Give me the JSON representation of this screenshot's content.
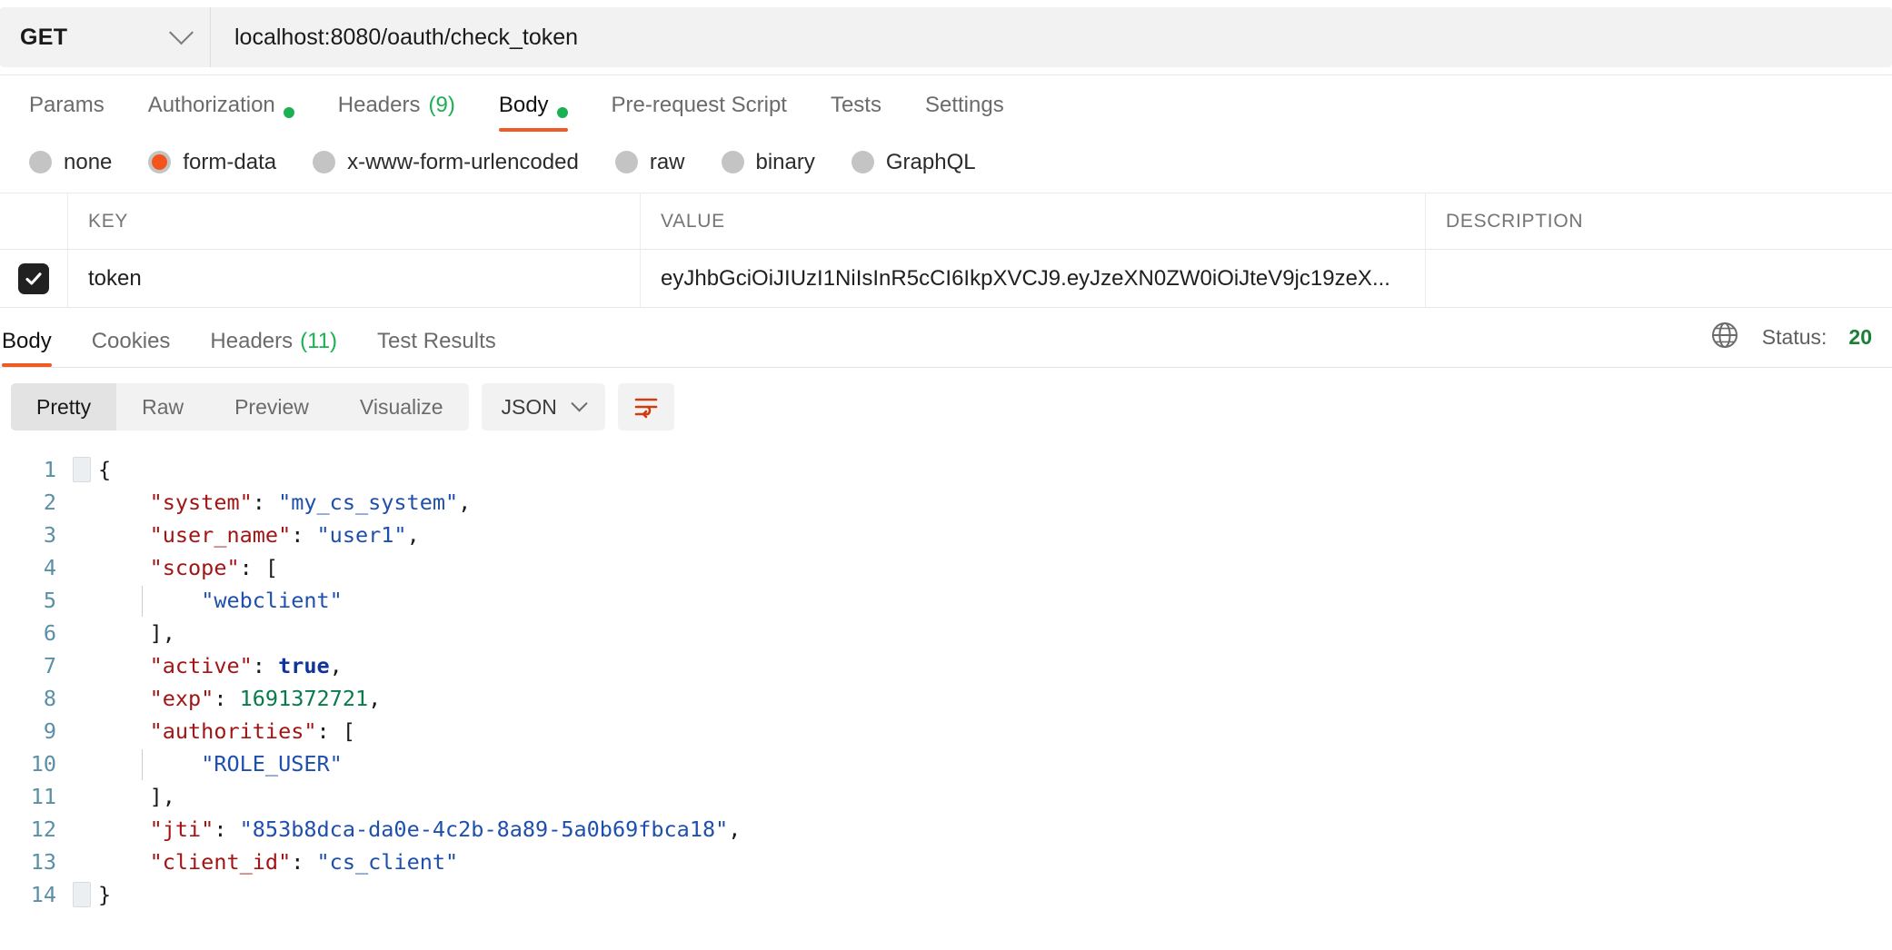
{
  "request": {
    "method": "GET",
    "url": "localhost:8080/oauth/check_token",
    "tabs": [
      {
        "label": "Params",
        "badge": "",
        "dot": false,
        "active": false
      },
      {
        "label": "Authorization",
        "badge": "",
        "dot": true,
        "active": false
      },
      {
        "label": "Headers",
        "badge": "(9)",
        "dot": false,
        "active": false
      },
      {
        "label": "Body",
        "badge": "",
        "dot": true,
        "active": true
      },
      {
        "label": "Pre-request Script",
        "badge": "",
        "dot": false,
        "active": false
      },
      {
        "label": "Tests",
        "badge": "",
        "dot": false,
        "active": false
      },
      {
        "label": "Settings",
        "badge": "",
        "dot": false,
        "active": false
      }
    ],
    "body_types": [
      {
        "label": "none",
        "selected": false
      },
      {
        "label": "form-data",
        "selected": true
      },
      {
        "label": "x-www-form-urlencoded",
        "selected": false
      },
      {
        "label": "raw",
        "selected": false
      },
      {
        "label": "binary",
        "selected": false
      },
      {
        "label": "GraphQL",
        "selected": false
      }
    ],
    "table": {
      "headers": {
        "key": "KEY",
        "value": "VALUE",
        "description": "DESCRIPTION"
      },
      "rows": [
        {
          "checked": true,
          "key": "token",
          "value": "eyJhbGciOiJIUzI1NiIsInR5cCI6IkpXVCJ9.eyJzeXN0ZW0iOiJteV9jc19zeX...",
          "description": ""
        }
      ]
    }
  },
  "response": {
    "tabs": [
      {
        "label": "Body",
        "badge": "",
        "active": true
      },
      {
        "label": "Cookies",
        "badge": "",
        "active": false
      },
      {
        "label": "Headers",
        "badge": "(11)",
        "active": false
      },
      {
        "label": "Test Results",
        "badge": "",
        "active": false
      }
    ],
    "status_label": "Status:",
    "status_code": "20",
    "globe_icon": "globe-icon",
    "view_modes": [
      {
        "label": "Pretty",
        "active": true
      },
      {
        "label": "Raw",
        "active": false
      },
      {
        "label": "Preview",
        "active": false
      },
      {
        "label": "Visualize",
        "active": false
      }
    ],
    "format": "JSON",
    "wrap_icon": "word-wrap-icon"
  },
  "code": {
    "lines": [
      {
        "n": "1",
        "indent": 0,
        "parts": [
          {
            "t": "p",
            "v": "{"
          }
        ]
      },
      {
        "n": "2",
        "indent": 1,
        "parts": [
          {
            "t": "key",
            "v": "\"system\""
          },
          {
            "t": "p",
            "v": ": "
          },
          {
            "t": "str",
            "v": "\"my_cs_system\""
          },
          {
            "t": "p",
            "v": ","
          }
        ]
      },
      {
        "n": "3",
        "indent": 1,
        "parts": [
          {
            "t": "key",
            "v": "\"user_name\""
          },
          {
            "t": "p",
            "v": ": "
          },
          {
            "t": "str",
            "v": "\"user1\""
          },
          {
            "t": "p",
            "v": ","
          }
        ]
      },
      {
        "n": "4",
        "indent": 1,
        "parts": [
          {
            "t": "key",
            "v": "\"scope\""
          },
          {
            "t": "p",
            "v": ": ["
          }
        ]
      },
      {
        "n": "5",
        "indent": 2,
        "parts": [
          {
            "t": "str",
            "v": "\"webclient\""
          }
        ]
      },
      {
        "n": "6",
        "indent": 1,
        "parts": [
          {
            "t": "p",
            "v": "],"
          }
        ]
      },
      {
        "n": "7",
        "indent": 1,
        "parts": [
          {
            "t": "key",
            "v": "\"active\""
          },
          {
            "t": "p",
            "v": ": "
          },
          {
            "t": "bool",
            "v": "true"
          },
          {
            "t": "p",
            "v": ","
          }
        ]
      },
      {
        "n": "8",
        "indent": 1,
        "parts": [
          {
            "t": "key",
            "v": "\"exp\""
          },
          {
            "t": "p",
            "v": ": "
          },
          {
            "t": "num",
            "v": "1691372721"
          },
          {
            "t": "p",
            "v": ","
          }
        ]
      },
      {
        "n": "9",
        "indent": 1,
        "parts": [
          {
            "t": "key",
            "v": "\"authorities\""
          },
          {
            "t": "p",
            "v": ": ["
          }
        ]
      },
      {
        "n": "10",
        "indent": 2,
        "parts": [
          {
            "t": "str",
            "v": "\"ROLE_USER\""
          }
        ]
      },
      {
        "n": "11",
        "indent": 1,
        "parts": [
          {
            "t": "p",
            "v": "],"
          }
        ]
      },
      {
        "n": "12",
        "indent": 1,
        "parts": [
          {
            "t": "key",
            "v": "\"jti\""
          },
          {
            "t": "p",
            "v": ": "
          },
          {
            "t": "str",
            "v": "\"853b8dca-da0e-4c2b-8a89-5a0b69fbca18\""
          },
          {
            "t": "p",
            "v": ","
          }
        ]
      },
      {
        "n": "13",
        "indent": 1,
        "parts": [
          {
            "t": "key",
            "v": "\"client_id\""
          },
          {
            "t": "p",
            "v": ": "
          },
          {
            "t": "str",
            "v": "\"cs_client\""
          }
        ]
      },
      {
        "n": "14",
        "indent": 0,
        "parts": [
          {
            "t": "p",
            "v": "}"
          }
        ]
      }
    ]
  },
  "colors": {
    "accent": "#ef5b25",
    "radio_selected": "#f2541b",
    "dot_green": "#1bb052",
    "status_green": "#1a7f37"
  }
}
